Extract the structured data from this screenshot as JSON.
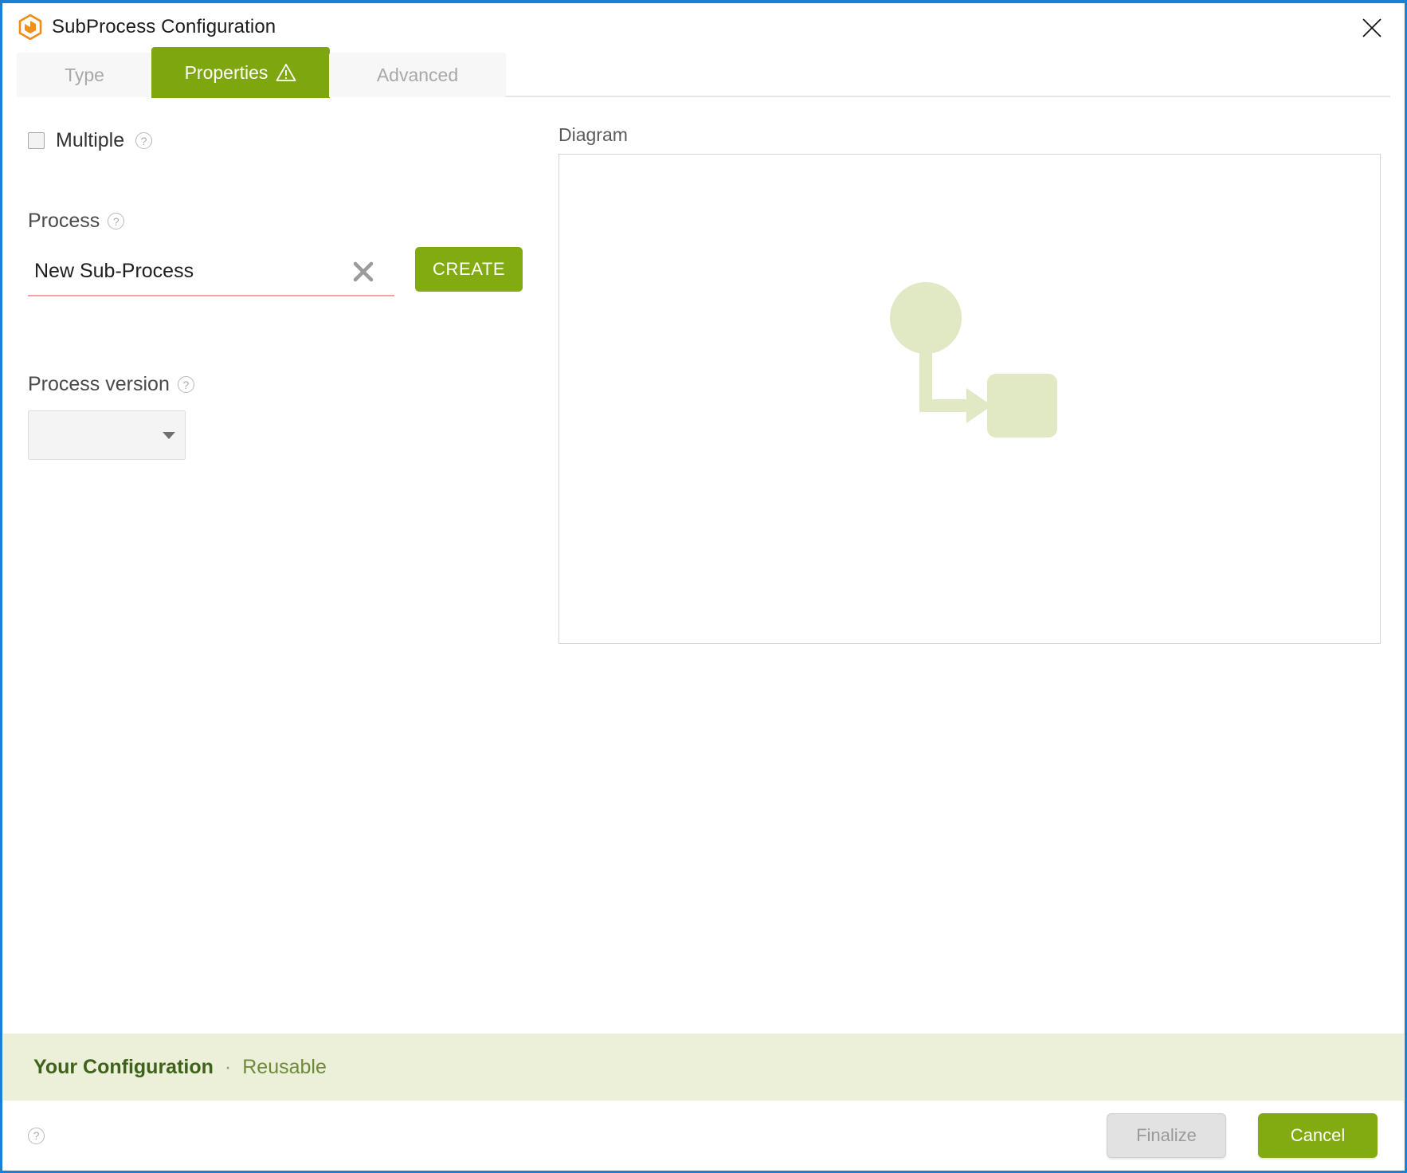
{
  "window": {
    "title": "SubProcess Configuration",
    "app_icon": "hexagon-cube-icon",
    "close_icon": "close-icon",
    "border_color": "#1b7fd4"
  },
  "tabs": [
    {
      "label": "Type",
      "active": false,
      "icon": null
    },
    {
      "label": "Properties",
      "active": true,
      "icon": "warning-triangle-icon"
    },
    {
      "label": "Advanced",
      "active": false,
      "icon": null
    }
  ],
  "form": {
    "multiple": {
      "label": "Multiple",
      "checked": false,
      "help_icon": "question-mark-icon"
    },
    "process": {
      "label": "Process",
      "help_icon": "question-mark-icon",
      "value": "New Sub-Process",
      "placeholder": "",
      "clear_icon": "clear-x-icon",
      "create_button": "CREATE",
      "invalid": true
    },
    "process_version": {
      "label": "Process version",
      "help_icon": "question-mark-icon",
      "value": "",
      "dropdown_icon": "chevron-down-icon"
    }
  },
  "diagram": {
    "label": "Diagram",
    "shapes": [
      {
        "type": "start-event-circle",
        "fill": "#e0e8c4"
      },
      {
        "type": "sequence-flow-arrow",
        "fill": "#e0e8c4"
      },
      {
        "type": "task-rounded-rect",
        "fill": "#e0e8c4"
      }
    ]
  },
  "banner": {
    "title": "Your Configuration",
    "separator": "·",
    "subtitle": "Reusable",
    "background": "#ecf0d8"
  },
  "footer": {
    "help_icon": "question-mark-icon",
    "finalize_label": "Finalize",
    "finalize_disabled": true,
    "cancel_label": "Cancel"
  },
  "colors": {
    "accent_green": "#82ab12",
    "tab_green": "#7ea70f",
    "diagram_green": "#e0e8c4",
    "error_underline": "#f0a3a3",
    "window_border_blue": "#1b7fd4"
  }
}
